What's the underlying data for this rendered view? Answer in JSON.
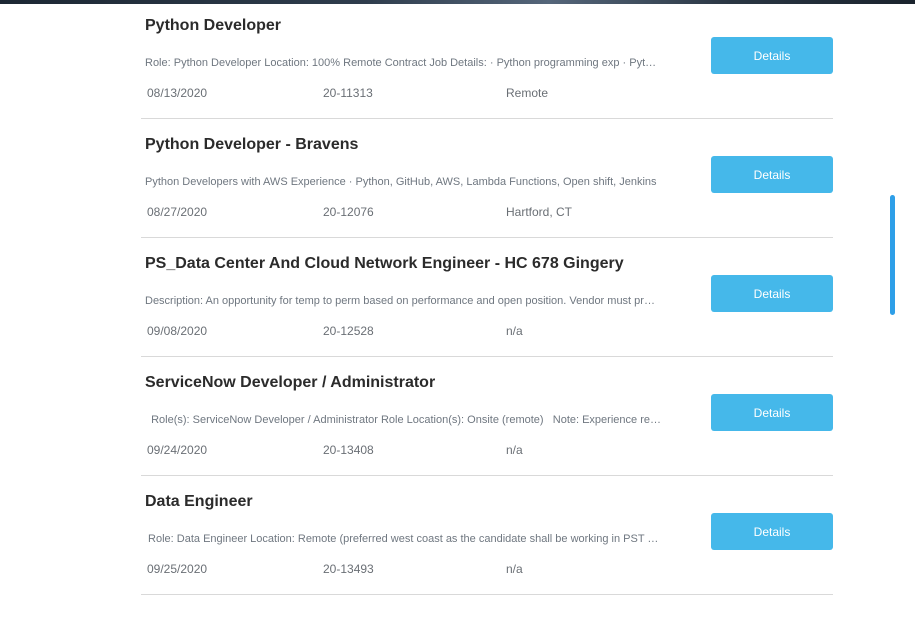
{
  "jobs": [
    {
      "title": "Python Developer",
      "description": "Role: Python Developer Location: 100% Remote Contract Job Details: · Python programming exp · Python automation",
      "date": "08/13/2020",
      "id": "20-11313",
      "location": "Remote",
      "button_label": "Details"
    },
    {
      "title": "Python Developer - Bravens",
      "description": "Python Developers with AWS Experience · Python, GitHub, AWS, Lambda Functions, Open shift, Jenkins",
      "date": "08/27/2020",
      "id": "20-12076",
      "location": "Hartford, CT",
      "button_label": "Details"
    },
    {
      "title": "PS_Data Center And Cloud Network Engineer - HC 678 Gingery",
      "description": "Description: An opportunity for temp to perm based on performance and open position. Vendor must provide",
      "date": "09/08/2020",
      "id": "20-12528",
      "location": "n/a",
      "button_label": "Details"
    },
    {
      "title": "ServiceNow Developer / Administrator",
      "description": "  Role(s): ServiceNow Developer / Administrator Role Location(s): Onsite (remote)   Note: Experience required",
      "date": "09/24/2020",
      "id": "20-13408",
      "location": "n/a",
      "button_label": "Details"
    },
    {
      "title": "Data Engineer",
      "description": " Role: Data Engineer Location: Remote (preferred west coast as the candidate shall be working in PST hours)",
      "date": "09/25/2020",
      "id": "20-13493",
      "location": "n/a",
      "button_label": "Details"
    }
  ]
}
